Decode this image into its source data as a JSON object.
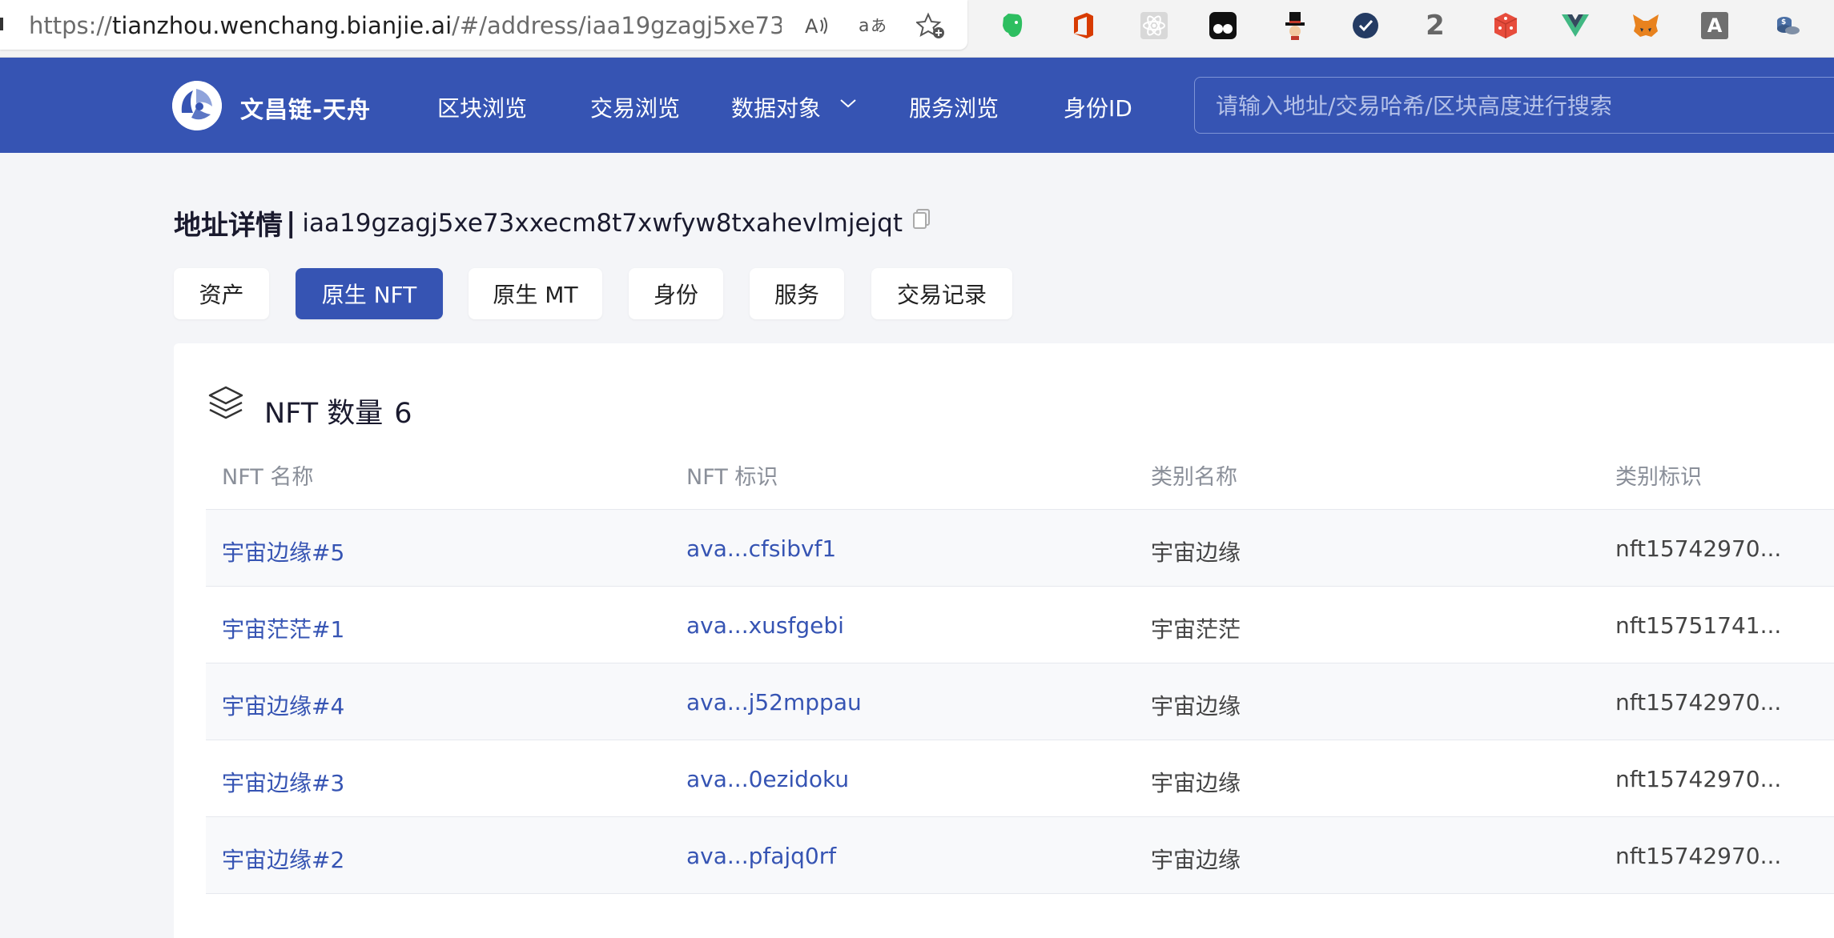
{
  "browser": {
    "url_prefix": "https://",
    "url_host": "tianzhou.wenchang.bianjie.ai",
    "url_path": "/#/address/iaa19gzagj5xe73xxec...",
    "extension_number": "2",
    "extension_letter": "A"
  },
  "header": {
    "site_name": "文昌链-天舟",
    "nav": [
      "区块浏览",
      "交易浏览",
      "数据对象",
      "服务浏览",
      "身份ID"
    ],
    "search_placeholder": "请输入地址/交易哈希/区块高度进行搜索"
  },
  "page": {
    "title_label": "地址详情",
    "title_sep": "|",
    "address": "iaa19gzagj5xe73xxecm8t7xwfyw8txahevlmjejqt"
  },
  "tabs": [
    "资产",
    "原生 NFT",
    "原生 MT",
    "身份",
    "服务",
    "交易记录"
  ],
  "active_tab": "原生 NFT",
  "card": {
    "title": "NFT 数量",
    "count": "6"
  },
  "table": {
    "columns": [
      "NFT 名称",
      "NFT 标识",
      "类别名称",
      "类别标识"
    ],
    "rows": [
      [
        "宇宙边缘#5",
        "ava...cfsibvf1",
        "宇宙边缘",
        "nft15742970..."
      ],
      [
        "宇宙茫茫#1",
        "ava...xusfgebi",
        "宇宙茫茫",
        "nft15751741..."
      ],
      [
        "宇宙边缘#4",
        "ava...j52mppau",
        "宇宙边缘",
        "nft15742970..."
      ],
      [
        "宇宙边缘#3",
        "ava...0ezidoku",
        "宇宙边缘",
        "nft15742970..."
      ],
      [
        "宇宙边缘#2",
        "ava...pfajq0rf",
        "宇宙边缘",
        "nft15742970..."
      ]
    ]
  },
  "colors": {
    "brand": "#3654b3",
    "link": "#3654b3",
    "page_bg": "#f4f5f8"
  }
}
